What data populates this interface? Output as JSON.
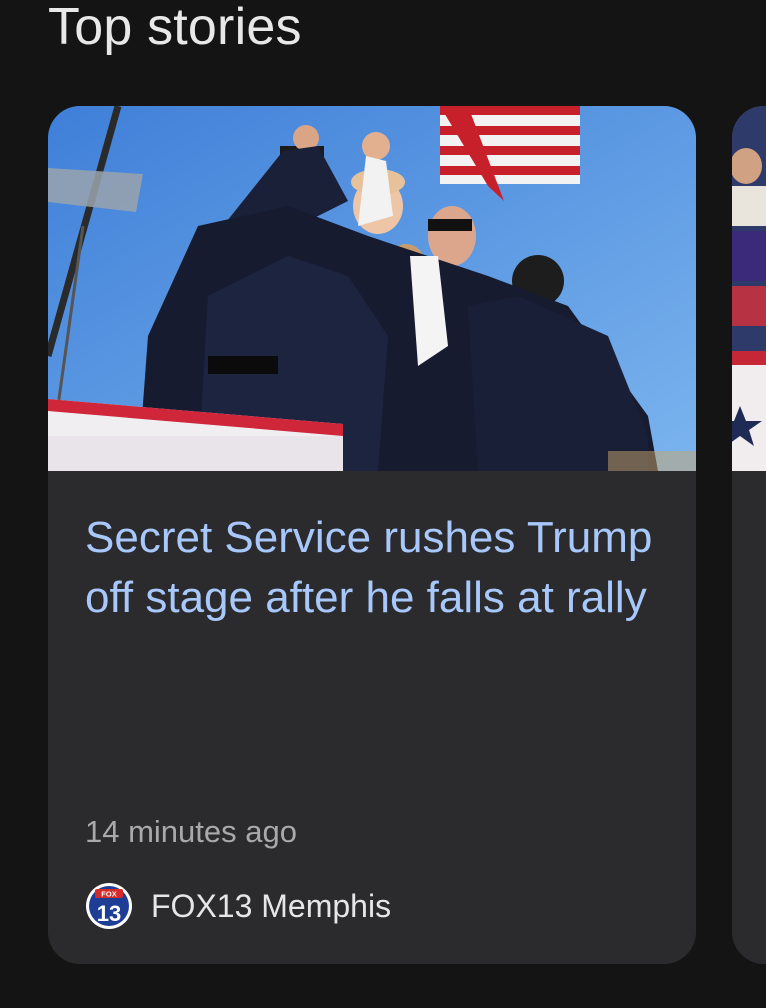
{
  "section": {
    "title": "Top stories"
  },
  "stories": [
    {
      "headline": "Secret Service rushes Trump off stage after he falls at rally",
      "time": "14 minutes ago",
      "source": "FOX13 Memphis",
      "source_logo": {
        "icon": "fox13-logo-icon",
        "top_text": "FOX",
        "number": "13"
      },
      "image": "rally-stage-photo"
    }
  ],
  "colors": {
    "background": "#141414",
    "card": "#2b2b2d",
    "headline": "#a8c7fa",
    "meta": "#a9a9ab"
  }
}
